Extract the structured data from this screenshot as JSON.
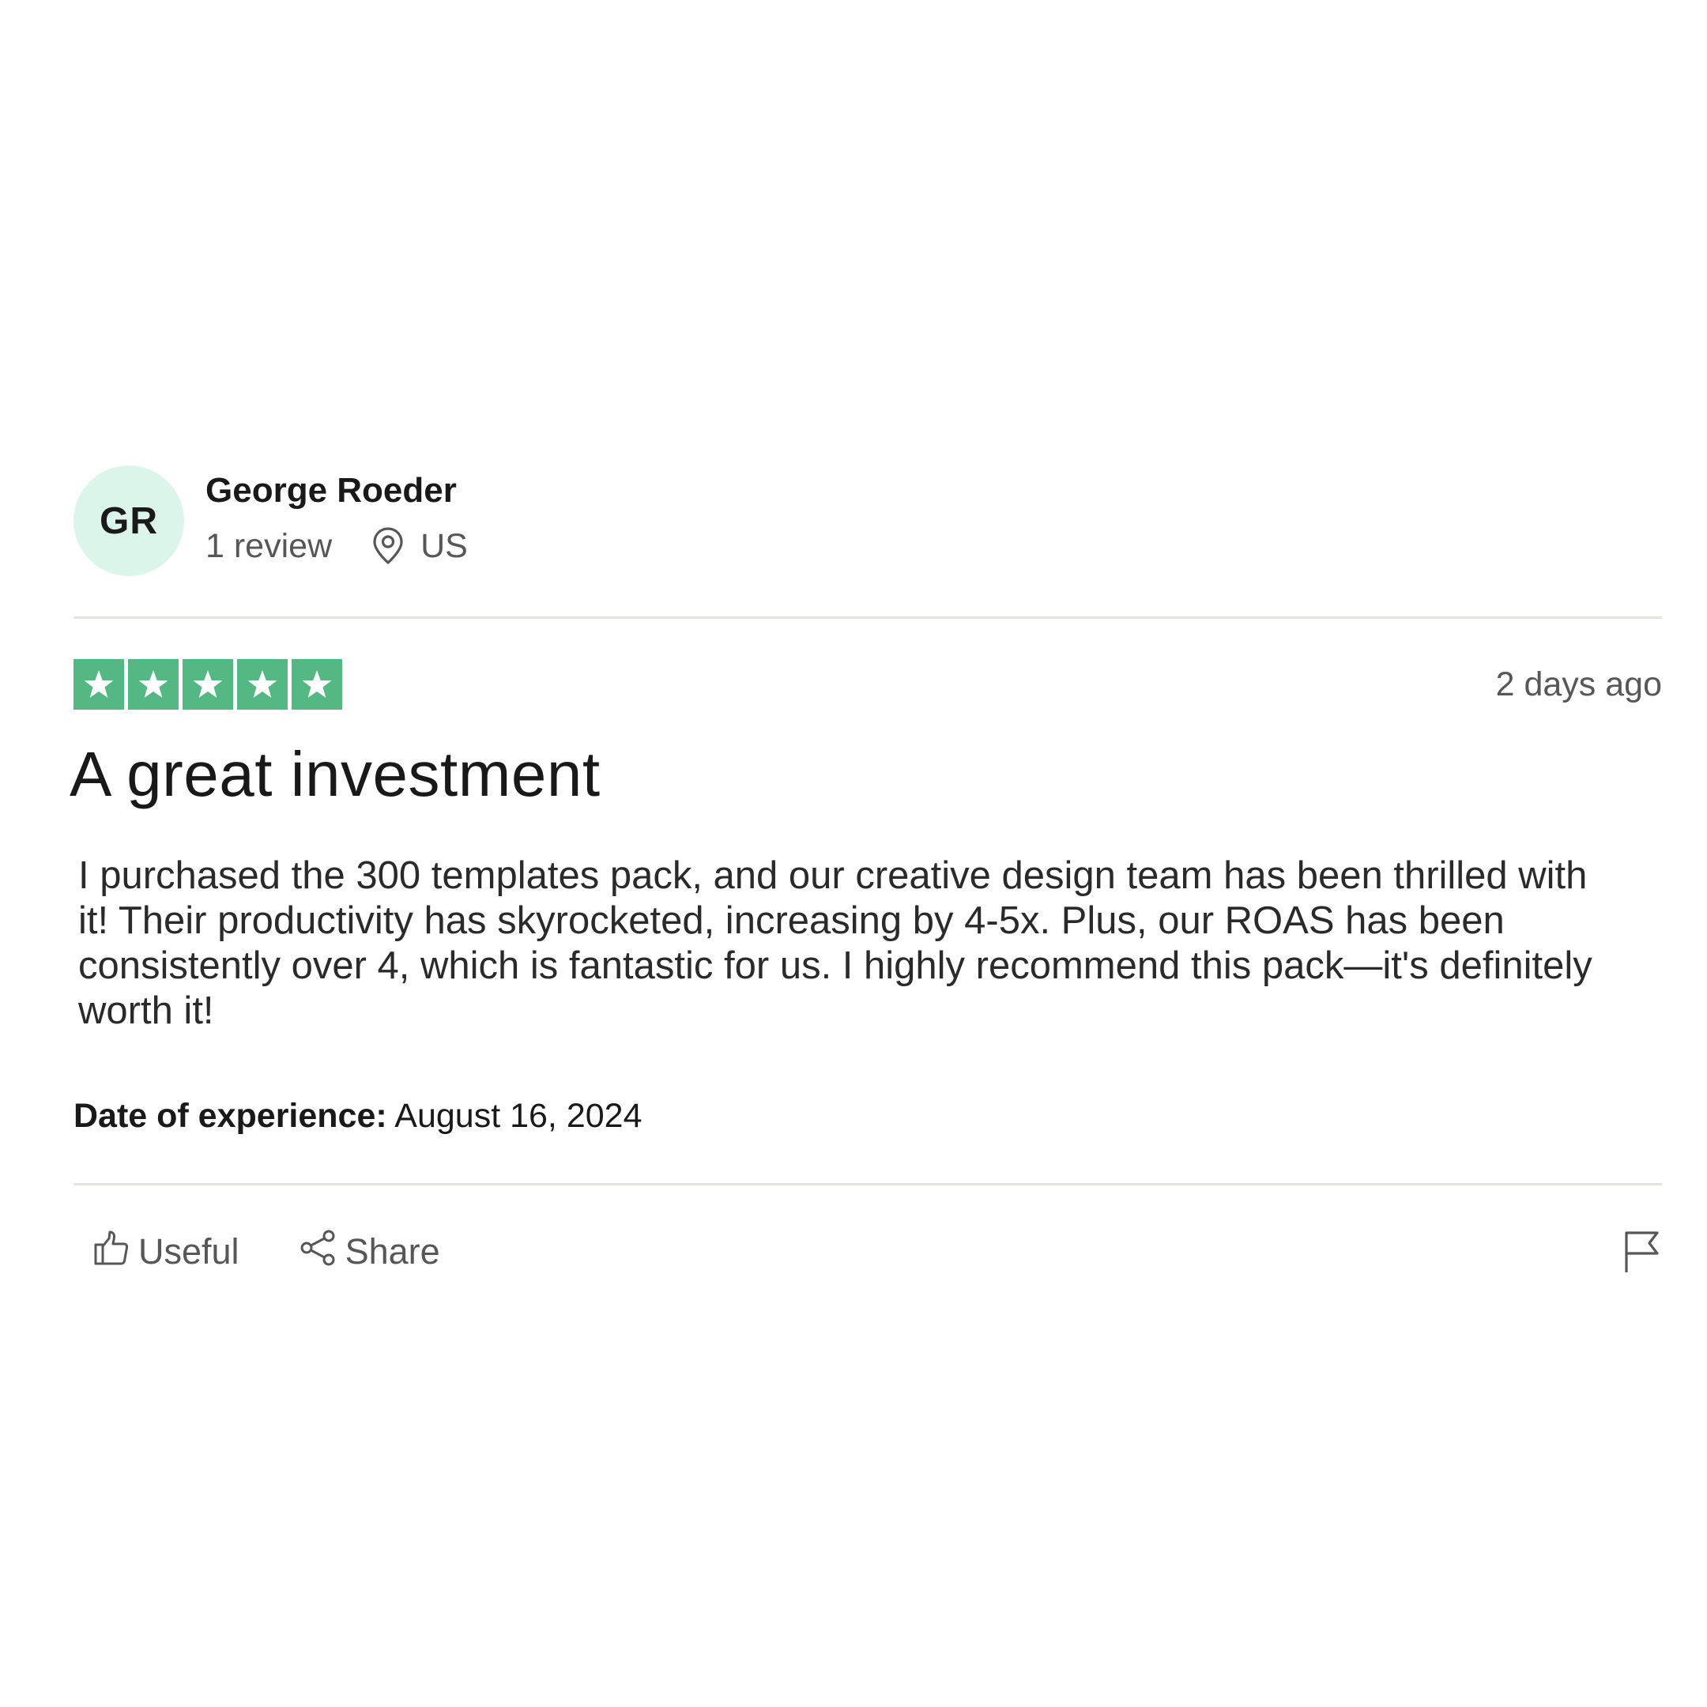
{
  "reviewer": {
    "initials": "GR",
    "name": "George Roeder",
    "review_count": "1 review",
    "country": "US",
    "avatar_color": "#dcf5ea"
  },
  "review": {
    "rating": 5,
    "max_rating": 5,
    "star_color": "#53b883",
    "posted": "2 days ago",
    "title": "A great investment",
    "body": "I purchased the 300 templates pack, and our creative design team has been thrilled with it! Their productivity has skyrocketed, increasing by 4-5x. Plus, our ROAS has been consistently over 4, which is fantastic for us. I highly recommend this pack—it's definitely worth it!",
    "experience_label": "Date of experience:",
    "experience_date": "August 16, 2024"
  },
  "actions": {
    "useful_label": "Useful",
    "share_label": "Share",
    "icons": [
      "thumbs-up-icon",
      "share-icon",
      "flag-icon",
      "location-pin-icon",
      "star-icon"
    ]
  }
}
